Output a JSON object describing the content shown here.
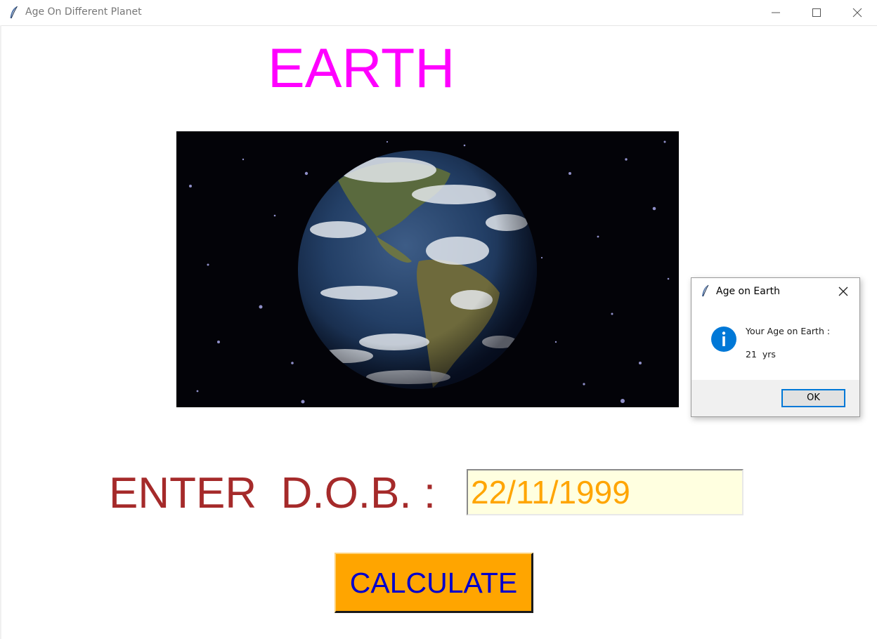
{
  "window": {
    "title": "Age On Different Planet",
    "icon": "feather-icon"
  },
  "main": {
    "planet_name": "EARTH",
    "planet_image": "earth-globe-image",
    "dob_label": "ENTER  D.O.B. : ",
    "dob_value": "22/11/1999",
    "calculate_label": "CALCULATE"
  },
  "dialog": {
    "title": "Age on Earth",
    "icon": "info-icon",
    "message_line1": "Your Age on Earth :",
    "message_line2": "21  yrs",
    "ok_label": "OK"
  },
  "colors": {
    "heading": "#ff00ff",
    "dob_label": "#a52a2a",
    "dob_text": "#ffa500",
    "dob_background": "#ffffe0",
    "button_background": "#ffa500",
    "button_text": "#0000cd",
    "info_icon": "#0078d7"
  }
}
